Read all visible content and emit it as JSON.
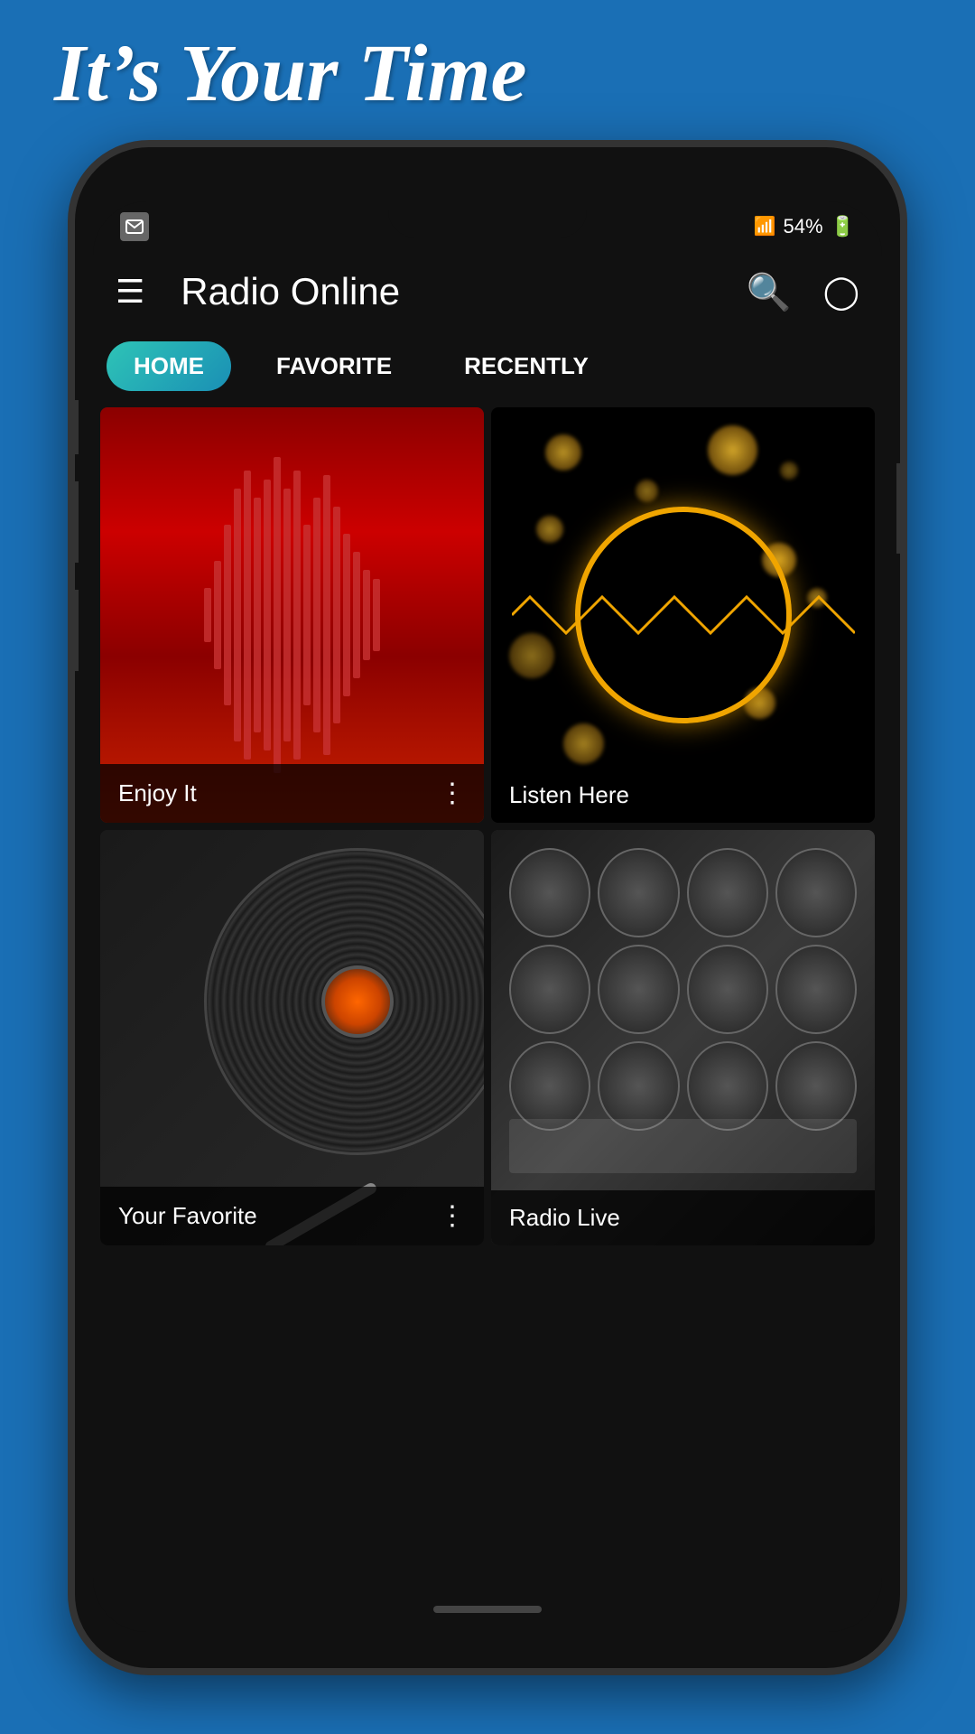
{
  "page": {
    "header_text": "It’s Your Time",
    "background_color": "#1a6fb5"
  },
  "status_bar": {
    "battery": "54%",
    "signal": "▲▲▲"
  },
  "app_header": {
    "title": "Radio Online",
    "search_label": "search",
    "menu_label": "menu"
  },
  "tabs": [
    {
      "label": "HOME",
      "active": true
    },
    {
      "label": "FAVORITE",
      "active": false
    },
    {
      "label": "RECENTLY",
      "active": false
    }
  ],
  "cards": [
    {
      "id": "card-1",
      "label": "Enjoy It",
      "has_menu": true,
      "theme": "red-waveform"
    },
    {
      "id": "card-2",
      "label": "Listen Here",
      "has_menu": false,
      "theme": "gold-bokeh"
    },
    {
      "id": "card-3",
      "label": "Your Favorite",
      "has_menu": true,
      "theme": "vinyl"
    },
    {
      "id": "card-4",
      "label": "Radio Live",
      "has_menu": false,
      "theme": "mixer"
    }
  ]
}
